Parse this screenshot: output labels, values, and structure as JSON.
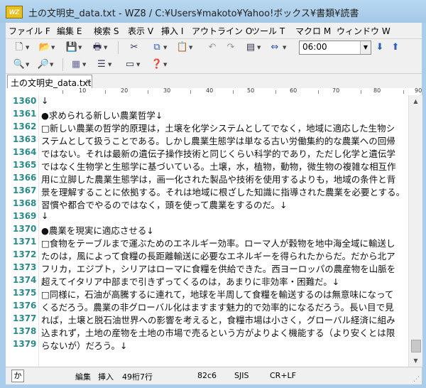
{
  "window": {
    "title": "土の文明史_data.txt - WZ8 / C:¥Users¥makoto¥Yahoo!ボックス¥書類¥読書",
    "app_icon": "WZ"
  },
  "menu": [
    {
      "label": "ファイル F"
    },
    {
      "label": "編集 E"
    },
    {
      "label": "検索 S"
    },
    {
      "label": "表示 V"
    },
    {
      "label": "挿入 I"
    },
    {
      "label": "アウトライン O"
    },
    {
      "label": "ツール T"
    },
    {
      "label": "マクロ M"
    },
    {
      "label": "ウィンドウ W"
    }
  ],
  "toolbar": {
    "time_value": "06:00",
    "icons_row1": [
      "new-file-icon",
      "open-folder-icon",
      "save-icon",
      "print-icon",
      "cut-icon",
      "copy-icon",
      "paste-icon",
      "undo-icon",
      "redo-icon",
      "document-format-icon",
      "view-mode-icon",
      "time-select",
      "down-arrow-icon",
      "up-arrow-icon"
    ],
    "icons_row2": [
      "find-icon",
      "find-dropdown-icon",
      "replace-icon",
      "grep-icon",
      "outline-icon",
      "window-icon",
      "help-icon"
    ]
  },
  "tab": {
    "label": "土の文明史_data.txt",
    "close": "×"
  },
  "ruler": {
    "numbers": [
      "10",
      "20",
      "30",
      "40",
      "50",
      "60",
      "70",
      "80",
      "90"
    ]
  },
  "editor": {
    "lines": [
      {
        "num": "1360",
        "text": "↓"
      },
      {
        "num": "1361",
        "text": "●求められる新しい農業哲学↓"
      },
      {
        "num": "1362",
        "text": "□新しい農業の哲学的原理は，土壌を化学システムとしてでなく，地域に適応した生物シ"
      },
      {
        "num": "1363",
        "text": "ステムとして扱うことである。しかし農業生態学は単なる古い労働集約的な農業への回帰"
      },
      {
        "num": "1364",
        "text": "ではない。それは最新の遺伝子操作技術と同じくらい科学的であり，ただし化学と遺伝学"
      },
      {
        "num": "1365",
        "text": "ではなく生物学と生態学に基づいている。土壌，水，植物，動物，微生物の複雑な相互作"
      },
      {
        "num": "1366",
        "text": "用に立脚した農業生態学は，画一化された製品や技術を使用するよりも，地域の条件と背"
      },
      {
        "num": "1367",
        "text": "景を理解することに依拠する。それは地域に根ざした知識に指導された農業を必要とする。"
      },
      {
        "num": "1368",
        "text": "習慣や都合でやるのではなく，頭を使って農業をするのだ。↓"
      },
      {
        "num": "1369",
        "text": "↓"
      },
      {
        "num": "1370",
        "text": "●農業を現実に適応させる↓"
      },
      {
        "num": "1371",
        "text": "□食物をテーブルまで運ぶためのエネルギー効率。ローマ人が穀物を地中海全域に輸送し"
      },
      {
        "num": "1372",
        "text": "たのは，風によって食糧の長距離輸送に必要なエネルギーを得られたからだ。だから北ア"
      },
      {
        "num": "1373",
        "text": "フリカ，エジプト，シリアはローマに食糧を供給できた。西ヨーロッパの農産物を山脈を"
      },
      {
        "num": "1374",
        "text": "超えてイタリア中部まで引きずってくるのは，あまりに非効率・困難だ。↓"
      },
      {
        "num": "1375",
        "text": "□同様に，石油が高騰するに連れて，地球を半周して食糧を輸送するのは無意味になって"
      },
      {
        "num": "1376",
        "text": "くるだろう。農業の非グローバル化はますます魅力的で効率的になるだろう。長い目で見"
      },
      {
        "num": "1377",
        "text": "れば，土壌と脱石油世界への影響を考えると，食糧市場は小さく，グローバル経済に組み"
      },
      {
        "num": "1378",
        "text": "込まれず，土地の産物を土地の市場で売るという方がよりよく機能する（より安くとは限"
      },
      {
        "num": "1379",
        "text": "らないが）だろう。↓"
      }
    ]
  },
  "status": {
    "ime": "か",
    "mode": "編集",
    "insert": "挿入",
    "position": "49桁7行",
    "code": "82c6",
    "encoding": "SJIS",
    "newline": "CR+LF"
  }
}
